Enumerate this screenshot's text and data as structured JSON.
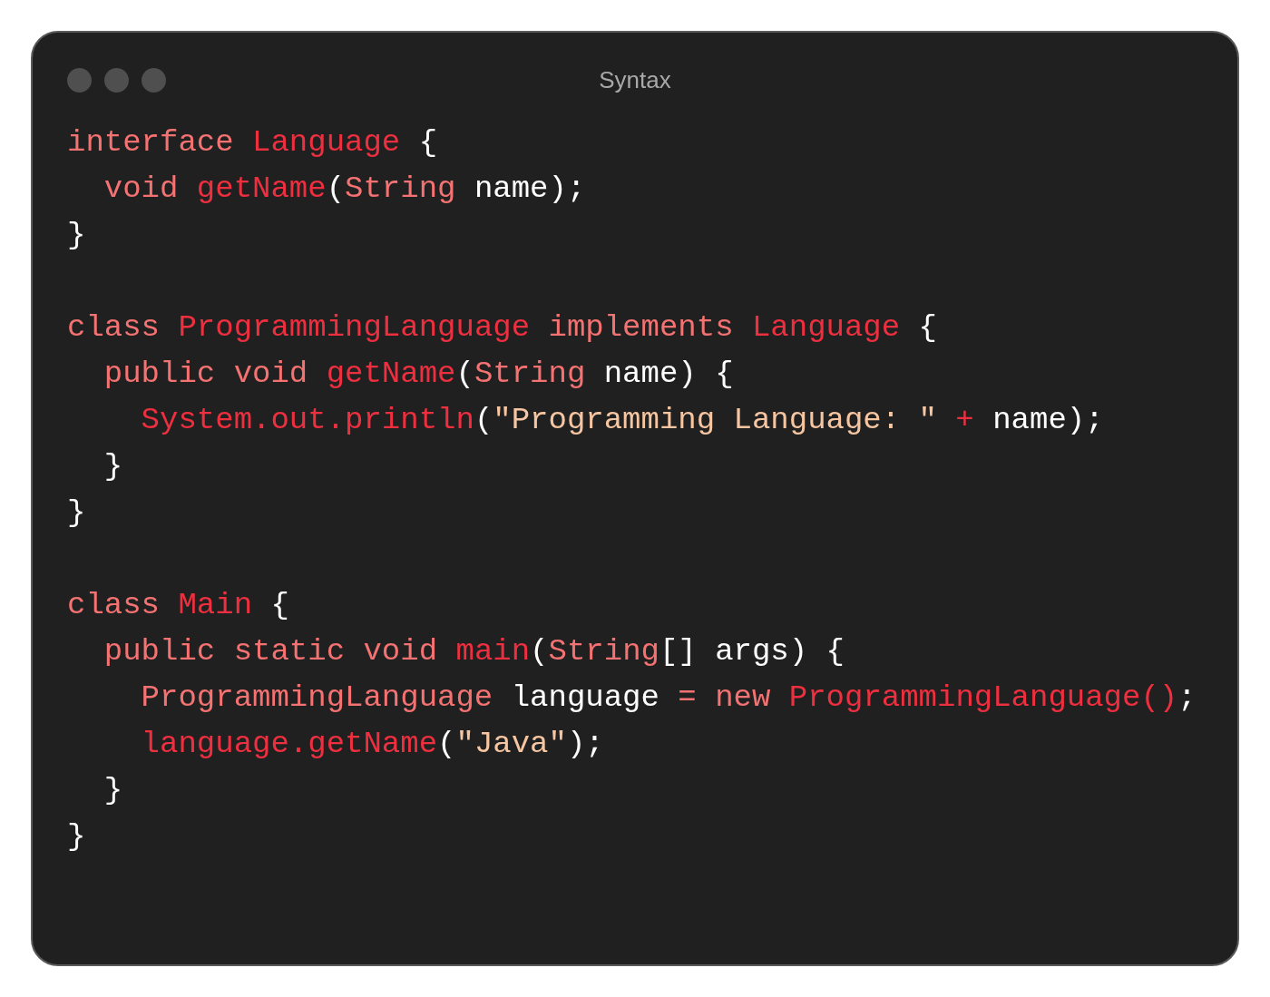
{
  "window": {
    "title": "Syntax"
  },
  "code_lines": [
    {
      "kind": "code",
      "tokens": [
        {
          "text": "interface ",
          "kind": "keyword"
        },
        {
          "text": "Language",
          "kind": "name"
        },
        {
          "text": " {",
          "kind": "plain"
        }
      ]
    },
    {
      "kind": "code",
      "tokens": [
        {
          "text": "  void ",
          "kind": "keyword"
        },
        {
          "text": "getName",
          "kind": "name"
        },
        {
          "text": "(",
          "kind": "plain"
        },
        {
          "text": "String",
          "kind": "keyword"
        },
        {
          "text": " name);",
          "kind": "plain"
        }
      ]
    },
    {
      "kind": "code",
      "tokens": [
        {
          "text": "}",
          "kind": "plain"
        }
      ]
    },
    {
      "kind": "blank"
    },
    {
      "kind": "code",
      "tokens": [
        {
          "text": "class ",
          "kind": "keyword"
        },
        {
          "text": "ProgrammingLanguage",
          "kind": "name"
        },
        {
          "text": " implements ",
          "kind": "keyword"
        },
        {
          "text": "Language",
          "kind": "name"
        },
        {
          "text": " {",
          "kind": "plain"
        }
      ]
    },
    {
      "kind": "code",
      "tokens": [
        {
          "text": "  public void ",
          "kind": "keyword"
        },
        {
          "text": "getName",
          "kind": "name"
        },
        {
          "text": "(",
          "kind": "plain"
        },
        {
          "text": "String",
          "kind": "keyword"
        },
        {
          "text": " name) {",
          "kind": "plain"
        }
      ]
    },
    {
      "kind": "code",
      "tokens": [
        {
          "text": "    System.out.println",
          "kind": "name"
        },
        {
          "text": "(",
          "kind": "plain"
        },
        {
          "text": "\"Programming Language: \"",
          "kind": "string"
        },
        {
          "text": " + ",
          "kind": "name"
        },
        {
          "text": "name);",
          "kind": "plain"
        }
      ]
    },
    {
      "kind": "code",
      "tokens": [
        {
          "text": "  }",
          "kind": "plain"
        }
      ]
    },
    {
      "kind": "code",
      "tokens": [
        {
          "text": "}",
          "kind": "plain"
        }
      ]
    },
    {
      "kind": "blank"
    },
    {
      "kind": "code",
      "tokens": [
        {
          "text": "class ",
          "kind": "keyword"
        },
        {
          "text": "Main",
          "kind": "name"
        },
        {
          "text": " {",
          "kind": "plain"
        }
      ]
    },
    {
      "kind": "code",
      "tokens": [
        {
          "text": "  public static void ",
          "kind": "keyword"
        },
        {
          "text": "main",
          "kind": "name"
        },
        {
          "text": "(",
          "kind": "plain"
        },
        {
          "text": "String",
          "kind": "keyword"
        },
        {
          "text": "[] args) {",
          "kind": "plain"
        }
      ]
    },
    {
      "kind": "code",
      "tokens": [
        {
          "text": "    ProgrammingLanguage ",
          "kind": "keyword"
        },
        {
          "text": "language ",
          "kind": "plain"
        },
        {
          "text": "= ",
          "kind": "keyword"
        },
        {
          "text": "new ",
          "kind": "keyword"
        },
        {
          "text": "ProgrammingLanguage()",
          "kind": "name"
        },
        {
          "text": ";",
          "kind": "plain"
        }
      ]
    },
    {
      "kind": "code",
      "tokens": [
        {
          "text": "    language.getName",
          "kind": "name"
        },
        {
          "text": "(",
          "kind": "plain"
        },
        {
          "text": "\"Java\"",
          "kind": "string"
        },
        {
          "text": ");",
          "kind": "plain"
        }
      ]
    },
    {
      "kind": "code",
      "tokens": [
        {
          "text": "  }",
          "kind": "plain"
        }
      ]
    },
    {
      "kind": "code",
      "tokens": [
        {
          "text": "}",
          "kind": "plain"
        }
      ]
    }
  ]
}
